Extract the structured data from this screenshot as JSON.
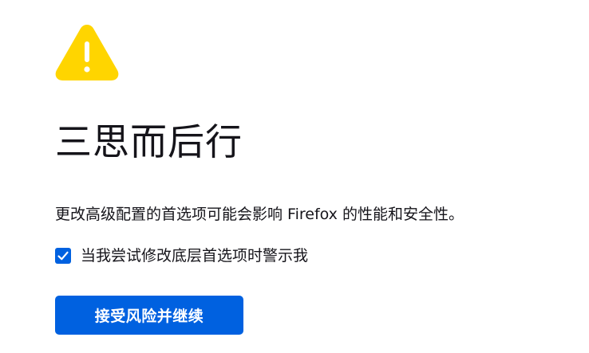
{
  "warning": {
    "icon": "warning-triangle-icon",
    "color": "#ffd500",
    "mark": "!"
  },
  "title": "三思而后行",
  "description": "更改高级配置的首选项可能会影响 Firefox 的性能和安全性。",
  "checkbox": {
    "checked": true,
    "label": "当我尝试修改底层首选项时警示我"
  },
  "accept_button": {
    "label": "接受风险并继续"
  },
  "colors": {
    "accent": "#0061e0",
    "warning": "#ffd500",
    "text": "#15141a"
  }
}
